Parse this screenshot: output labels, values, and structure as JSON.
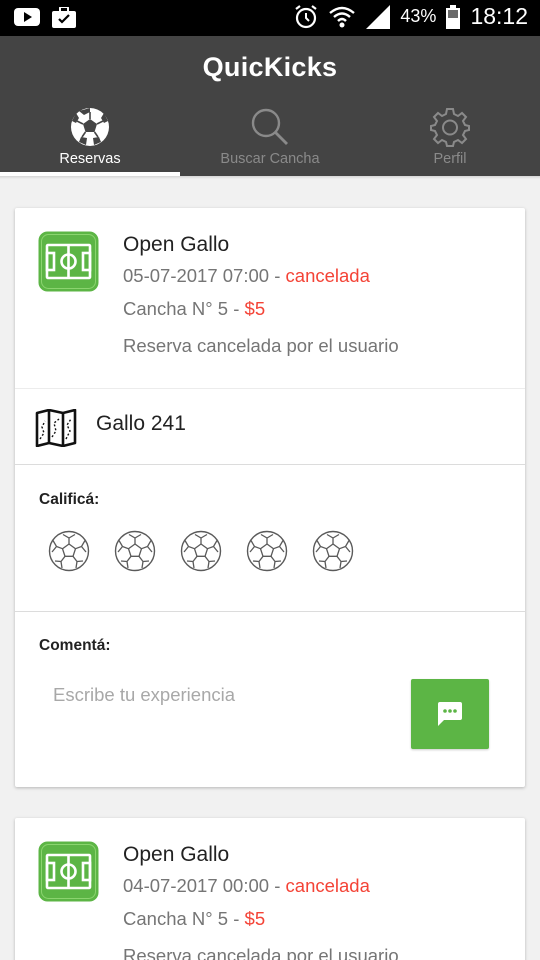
{
  "status_bar": {
    "battery": "43%",
    "time": "18:12",
    "icons": [
      "youtube-icon",
      "briefcase-icon",
      "alarm-icon",
      "wifi-icon",
      "signal-icon",
      "battery-icon"
    ]
  },
  "app": {
    "title": "QuicKicks"
  },
  "tabs": [
    {
      "label": "Reservas",
      "icon": "soccer-ball-icon",
      "active": true
    },
    {
      "label": "Buscar Cancha",
      "icon": "search-icon",
      "active": false
    },
    {
      "label": "Perfil",
      "icon": "gear-icon",
      "active": false
    }
  ],
  "colors": {
    "app_bar": "#444444",
    "accent_green": "#5cb545",
    "status_red": "#f44336"
  },
  "reservations": [
    {
      "venue": "Open Gallo",
      "datetime": "05-07-2017 07:00",
      "sep1": " - ",
      "status": "cancelada",
      "court": "Cancha N° 5",
      "sep2": " - ",
      "price": "$5",
      "note": "Reserva cancelada por el usuario",
      "address": "Gallo 241",
      "rate_label": "Calificá:",
      "rating": 0,
      "rating_max": 5,
      "comment_label": "Comentá:",
      "comment_value": "",
      "comment_placeholder": "Escribe tu experiencia"
    },
    {
      "venue": "Open Gallo",
      "datetime": "04-07-2017 00:00",
      "sep1": " - ",
      "status": "cancelada",
      "court": "Cancha N° 5",
      "sep2": " - ",
      "price": "$5",
      "note": "Reserva cancelada por el usuario"
    }
  ]
}
